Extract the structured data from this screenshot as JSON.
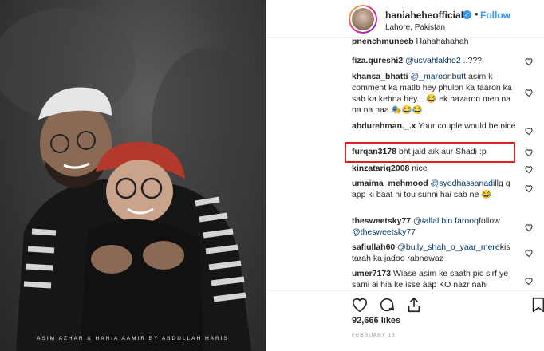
{
  "photo": {
    "caption": "ASIM AZHAR & HANIA AAMIR BY ABDULLAH HARIS"
  },
  "header": {
    "username": "haniaheheofficial",
    "verified_glyph": "✓",
    "separator": "•",
    "follow_label": "Follow",
    "location": "Lahore, Pakistan"
  },
  "comments": [
    {
      "user": "pnenchmuneeb",
      "text": " Hahahahahah",
      "partial": true
    },
    {
      "user": "fiza.qureshi2",
      "mention": "@usvahlakho2",
      "text": " ..???"
    },
    {
      "user": "khansa_bhatti",
      "mention": "@_maroonbutt",
      "text": " asim k comment ka matlb hey phulon ka taaron ka sab ka kehna hey... 😂 ek hazaron men na na na naa 🎭😂😂"
    },
    {
      "user": "abdurehman._.x",
      "text": " Your couple would be nice"
    },
    {
      "user": "furqan3178",
      "text": " bht jald aik aur Shadi :p"
    },
    {
      "user": "kinzatariq2008",
      "text": " nice"
    },
    {
      "user": "umaima_mehmood",
      "mention": "@syedhassanadill",
      "text": "g g app ki baat hi tou sunni hai sab ne 😂"
    },
    {
      "user": "thesweetsky77",
      "mention": "@tallal.bin.farooq",
      "text": "follow ",
      "mention2": "@thesweetsky77"
    },
    {
      "user": "safiullah60",
      "mention": "@bully_shah_o_yaar_mere",
      "text": "kis tarah ka jadoo rabnawaz"
    },
    {
      "user": "umer7173",
      "text": " Wiase asim ke saath pic sirf ye sami ai hia ke isse aap KO nazr nahi"
    }
  ],
  "actions": {
    "likes": "92,666 likes",
    "date": "FEBRUARY 18"
  },
  "colors": {
    "accent": "#3897f0",
    "highlight_border": "#e02020",
    "text": "#262626",
    "mention": "#003569"
  },
  "icons": [
    "heart-icon",
    "comment-icon",
    "share-icon",
    "bookmark-icon",
    "verified-icon"
  ]
}
